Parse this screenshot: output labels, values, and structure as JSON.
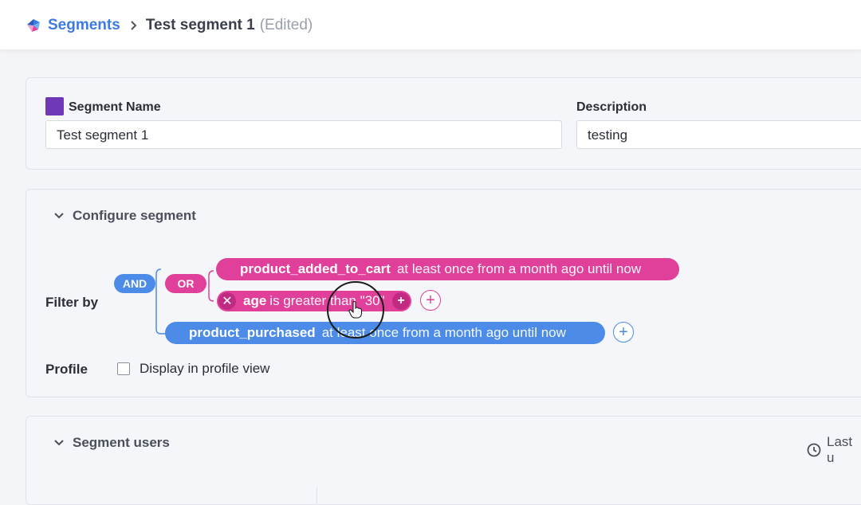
{
  "breadcrumb": {
    "root": "Segments",
    "current": "Test segment 1",
    "edited": "(Edited)"
  },
  "segment_form": {
    "name_label": "Segment Name",
    "name_value": "Test segment 1",
    "description_label": "Description",
    "description_value": "testing",
    "color": "#6f38b8"
  },
  "configure": {
    "title": "Configure segment",
    "filter_label": "Filter by",
    "and_label": "AND",
    "or_label": "OR",
    "filters": [
      {
        "event": "product_added_to_cart",
        "condition": "at least once from a month ago until now"
      },
      {
        "event": "age",
        "condition": "is greater than \"30\""
      },
      {
        "event": "product_purchased",
        "condition": "at least once from a month ago until now"
      }
    ],
    "profile_label": "Profile",
    "profile_checkbox_label": "Display in profile view",
    "profile_checked": false
  },
  "segment_users": {
    "title": "Segment users",
    "last_updated_label": "Last u"
  },
  "colors": {
    "accent": "#3d7be0",
    "pink": "#e0409a",
    "blue": "#4c8be8"
  }
}
